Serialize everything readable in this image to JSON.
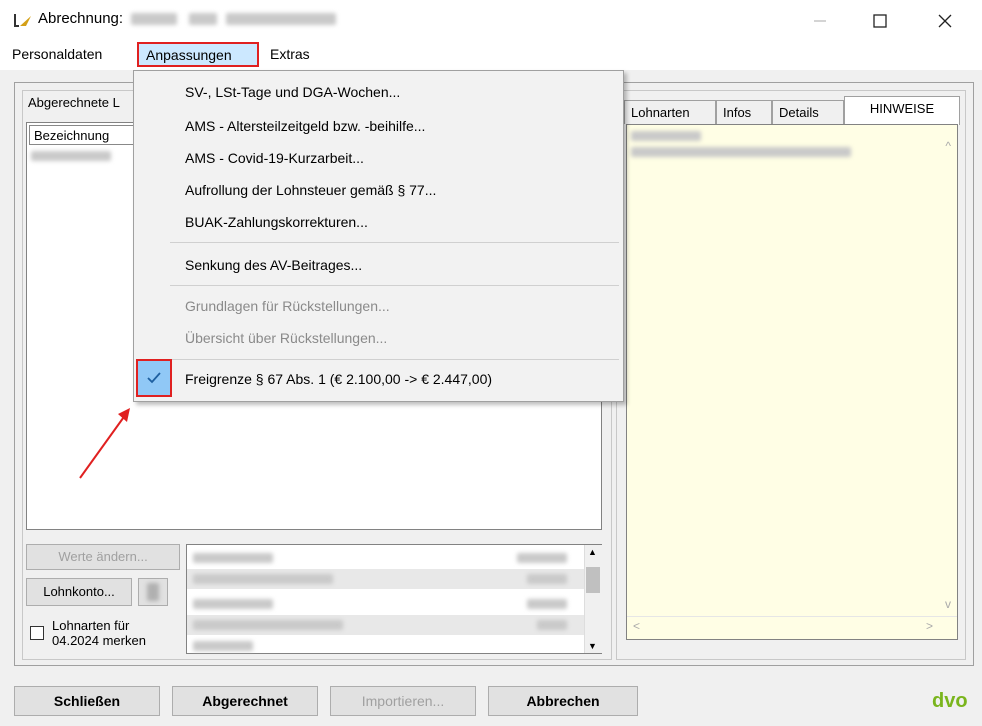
{
  "window": {
    "title_prefix": "Abrechnung:",
    "minimize_icon": "minimize-icon",
    "maximize_icon": "maximize-icon",
    "close_icon": "close-icon"
  },
  "menubar": {
    "items": [
      "Personaldaten",
      "Anpassungen",
      "Extras"
    ]
  },
  "left_panel": {
    "group_label": "Abgerechnete L",
    "column_header": "Bezeichnung",
    "btn_werte": "Werte ändern...",
    "btn_lohnkonto": "Lohnkonto...",
    "checkbox_label_line1": "Lohnarten für",
    "checkbox_label_line2": "04.2024 merken"
  },
  "tabs": [
    "Lohnarten",
    "Infos",
    "Details",
    "HINWEISE"
  ],
  "dropdown": {
    "items": [
      "SV-, LSt-Tage und DGA-Wochen...",
      "AMS - Altersteilzeitgeld bzw. -beihilfe...",
      "AMS - Covid-19-Kurzarbeit...",
      "Aufrollung der Lohnsteuer gemäß § 77...",
      "BUAK-Zahlungskorrekturen...",
      "Senkung des AV-Beitrages...",
      "Grundlagen für Rückstellungen...",
      "Übersicht über Rückstellungen...",
      "Freigrenze § 67 Abs. 1 (€ 2.100,00 -> € 2.447,00)"
    ]
  },
  "footer": {
    "btn_close": "Schließen",
    "btn_settled": "Abgerechnet",
    "btn_import": "Importieren...",
    "btn_cancel": "Abbrechen",
    "logo": "dvo"
  },
  "colors": {
    "highlight_red": "#e02020",
    "menu_active_bg": "#cce8ff",
    "check_bg": "#90c8f6",
    "notes_bg": "#fffee5",
    "logo_green": "#7ab51d"
  }
}
